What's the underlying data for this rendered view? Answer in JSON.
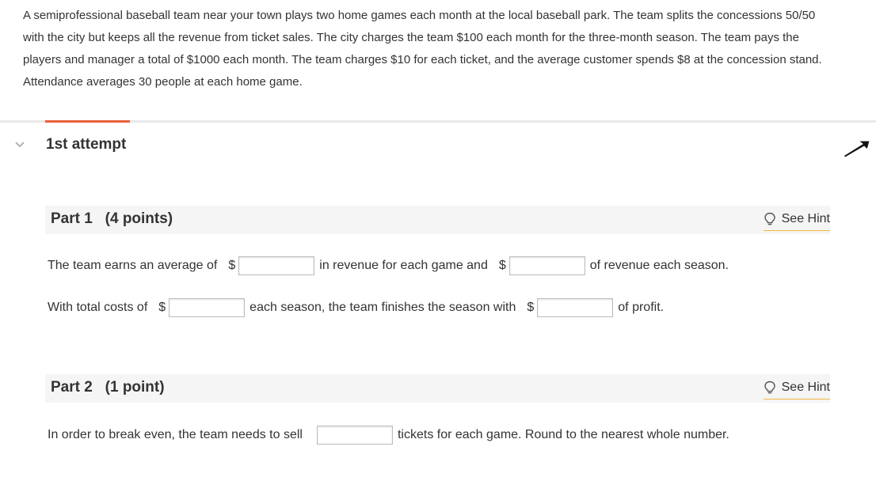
{
  "problem": {
    "lines": [
      "A semiprofessional baseball team near your town plays two home games each month at the local baseball park. The team splits the concessions 50/50",
      "with the city but keeps all the revenue from ticket sales. The city charges the team $100  each month for the three-month season. The team pays the",
      "players and manager a total of $1000 each month. The team charges $10 for each ticket, and the average customer spends $8 at the concession stand.",
      "Attendance averages  30 people at each home game."
    ]
  },
  "attempt": {
    "title": "1st attempt"
  },
  "part1": {
    "title": "Part 1   (4 points)",
    "hint_label": "See Hint",
    "line1": {
      "text_a": "The team earns an average of",
      "dollar_a": "$",
      "text_b": "in revenue for each game and",
      "dollar_b": "$",
      "text_c": "of revenue each season.",
      "input_a_value": "",
      "input_b_value": ""
    },
    "line2": {
      "text_a": "With total costs of",
      "dollar_a": "$",
      "text_b": "each season, the team finishes the season with",
      "dollar_b": "$",
      "text_c": "of profit.",
      "input_a_value": "",
      "input_b_value": ""
    }
  },
  "part2": {
    "title": "Part 2   (1 point)",
    "hint_label": "See Hint",
    "line1": {
      "text_a": "In order to break even, the team needs to sell",
      "text_b": "tickets for each game. Round to the nearest whole number.",
      "input_value": ""
    }
  },
  "colors": {
    "accent": "#e8603c",
    "hint_underline": "#f0b63f",
    "part_header_bg": "#f5f5f5"
  },
  "icons": {
    "attempt_toggle": "chevron-down-icon",
    "hint": "lightbulb-icon",
    "cursor": "mouse-pointer-icon"
  }
}
